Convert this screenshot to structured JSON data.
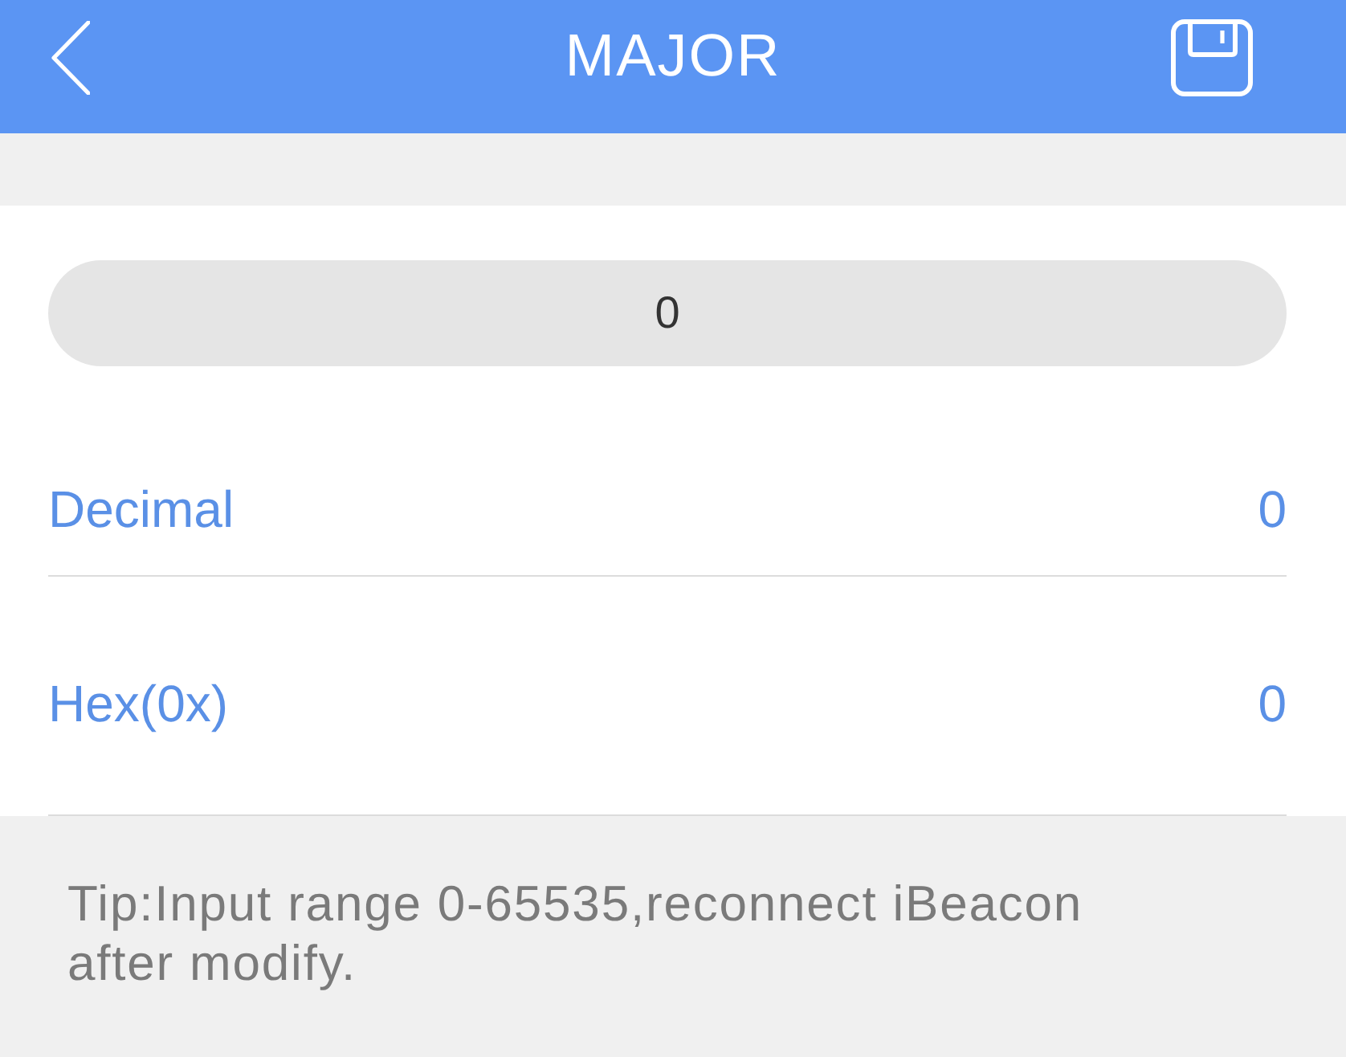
{
  "header": {
    "title": "MAJOR"
  },
  "input": {
    "value": "0"
  },
  "rows": [
    {
      "label": "Decimal",
      "value": "0"
    },
    {
      "label": "Hex(0x)",
      "value": "0"
    }
  ],
  "tip": "Tip:Input range 0-65535,reconnect iBeacon after modify."
}
